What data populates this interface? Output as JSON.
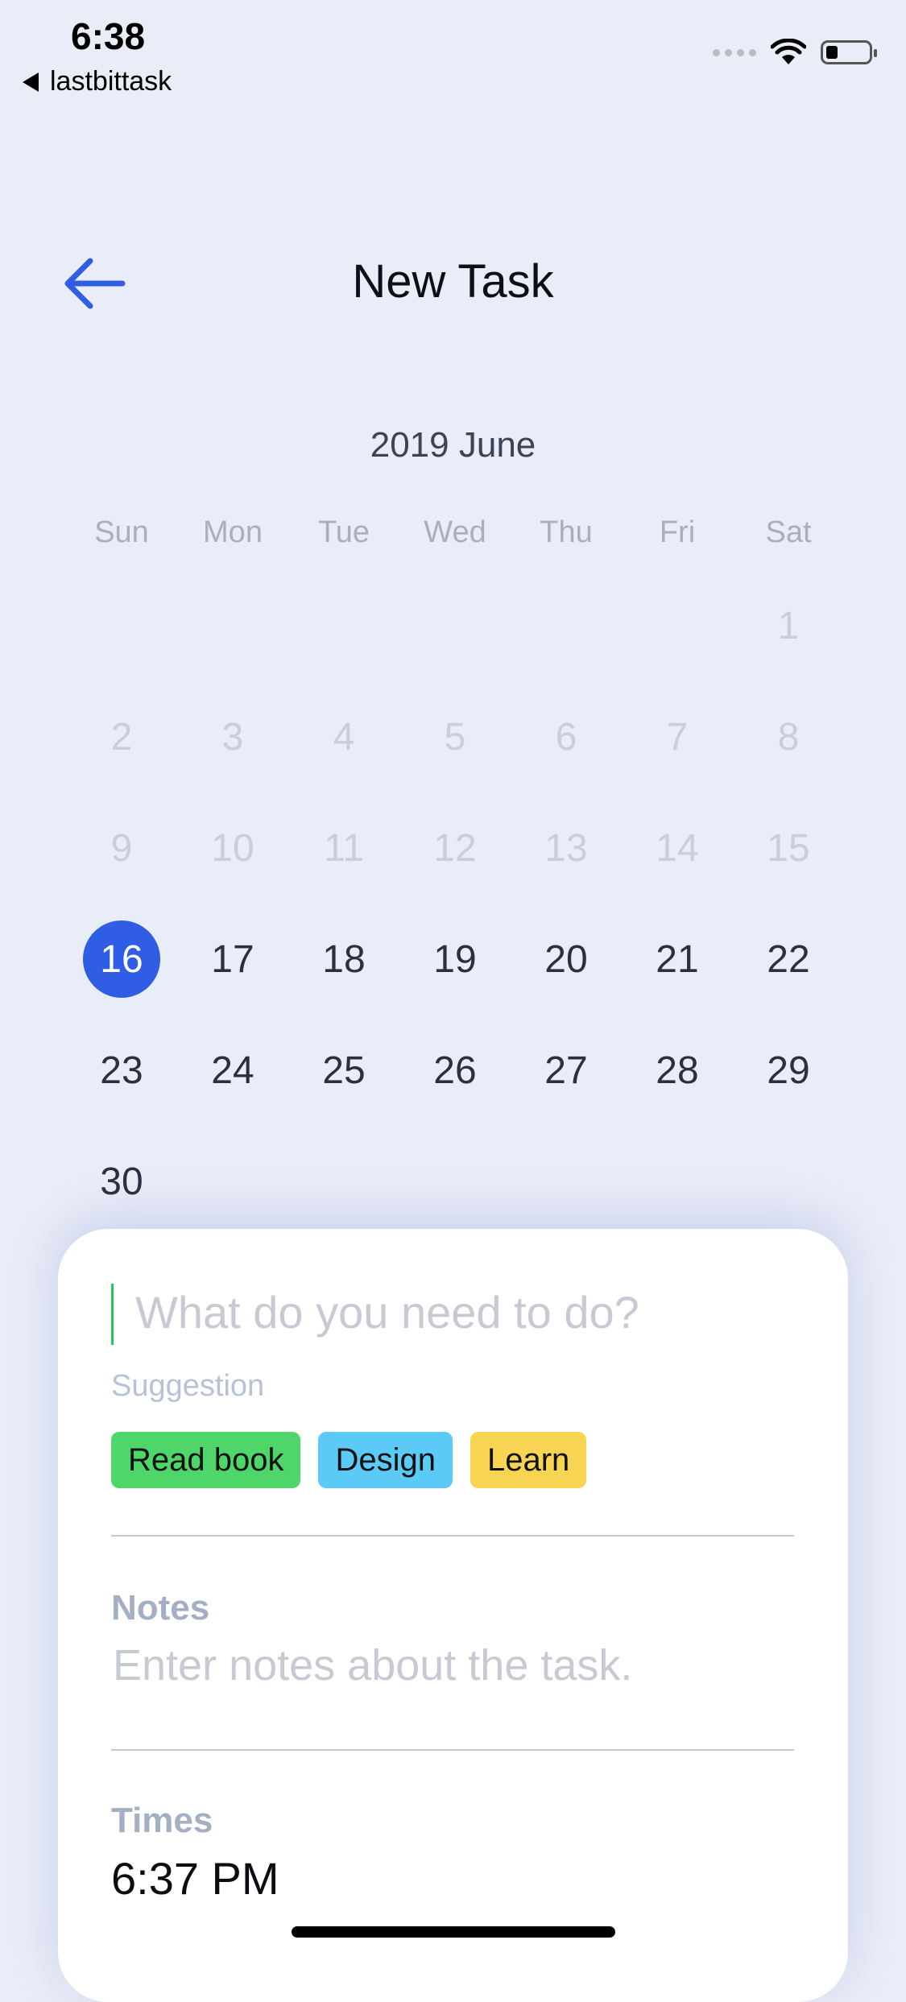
{
  "status_bar": {
    "time": "6:38",
    "back_app": "lastbittask"
  },
  "header": {
    "title": "New Task",
    "accent_color": "#2f5ee4"
  },
  "calendar": {
    "month_label": "2019 June",
    "weekdays": [
      "Sun",
      "Mon",
      "Tue",
      "Wed",
      "Thu",
      "Fri",
      "Sat"
    ],
    "selected_day": "16",
    "weeks": [
      [
        "",
        "",
        "",
        "",
        "",
        "",
        "1"
      ],
      [
        "2",
        "3",
        "4",
        "5",
        "6",
        "7",
        "8"
      ],
      [
        "9",
        "10",
        "11",
        "12",
        "13",
        "14",
        "15"
      ],
      [
        "16",
        "17",
        "18",
        "19",
        "20",
        "21",
        "22"
      ],
      [
        "23",
        "24",
        "25",
        "26",
        "27",
        "28",
        "29"
      ],
      [
        "30",
        "",
        "",
        "",
        "",
        "",
        ""
      ]
    ]
  },
  "form": {
    "task_placeholder": "What do you need to do?",
    "suggestion_label": "Suggestion",
    "suggestions": [
      {
        "label": "Read book",
        "color": "#4fd66a"
      },
      {
        "label": "Design",
        "color": "#5ccaf7"
      },
      {
        "label": "Learn",
        "color": "#f7d451"
      }
    ],
    "notes_label": "Notes",
    "notes_placeholder": "Enter notes about the task.",
    "times_label": "Times",
    "time_value": "6:37 PM"
  }
}
